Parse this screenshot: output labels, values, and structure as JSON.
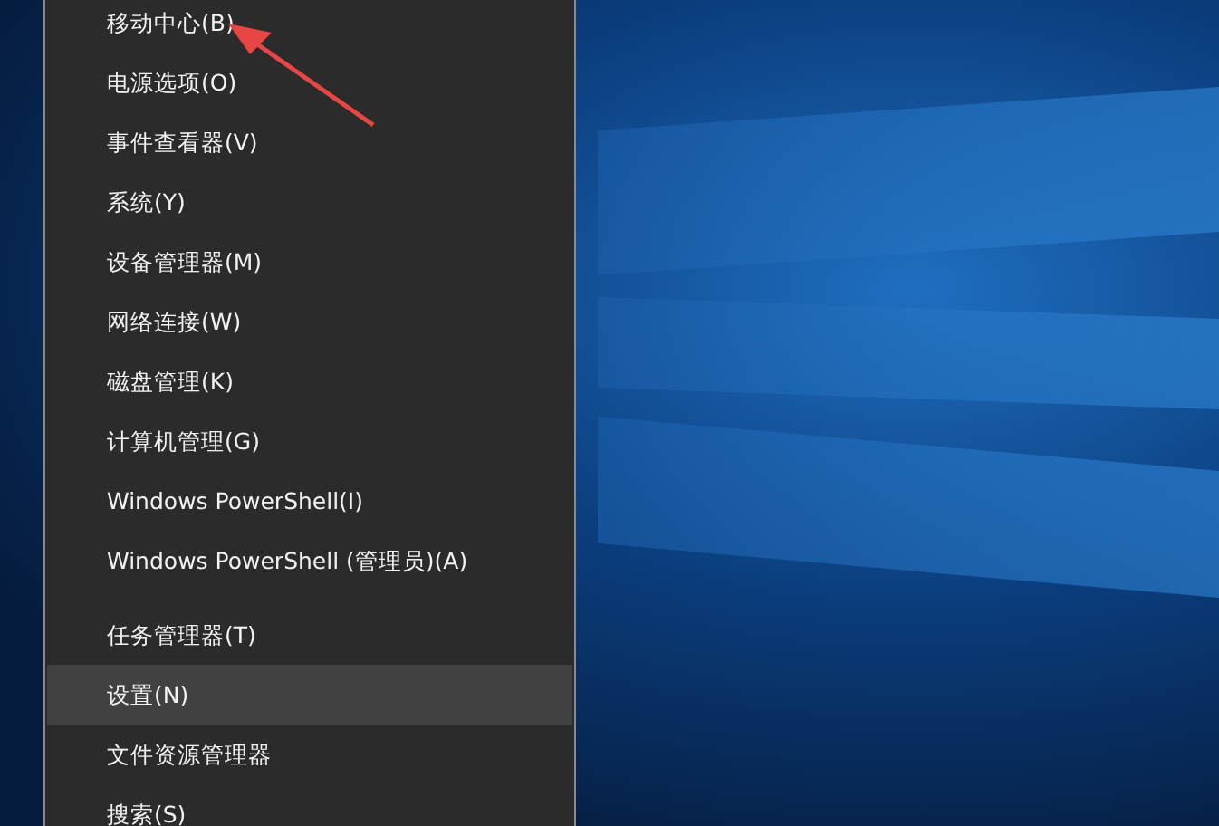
{
  "menu": {
    "sections": [
      {
        "items": [
          {
            "label": "移动中心(B)",
            "selected": false
          },
          {
            "label": "电源选项(O)",
            "selected": false
          },
          {
            "label": "事件查看器(V)",
            "selected": false
          },
          {
            "label": "系统(Y)",
            "selected": false
          },
          {
            "label": "设备管理器(M)",
            "selected": false
          },
          {
            "label": "网络连接(W)",
            "selected": false
          },
          {
            "label": "磁盘管理(K)",
            "selected": false
          },
          {
            "label": "计算机管理(G)",
            "selected": false
          },
          {
            "label": "Windows PowerShell(I)",
            "selected": false
          },
          {
            "label": "Windows PowerShell (管理员)(A)",
            "selected": false
          }
        ]
      },
      {
        "items": [
          {
            "label": "任务管理器(T)",
            "selected": false
          },
          {
            "label": "设置(N)",
            "selected": true
          },
          {
            "label": "文件资源管理器",
            "selected": false
          },
          {
            "label": "搜索(S)",
            "selected": false
          }
        ]
      }
    ]
  }
}
